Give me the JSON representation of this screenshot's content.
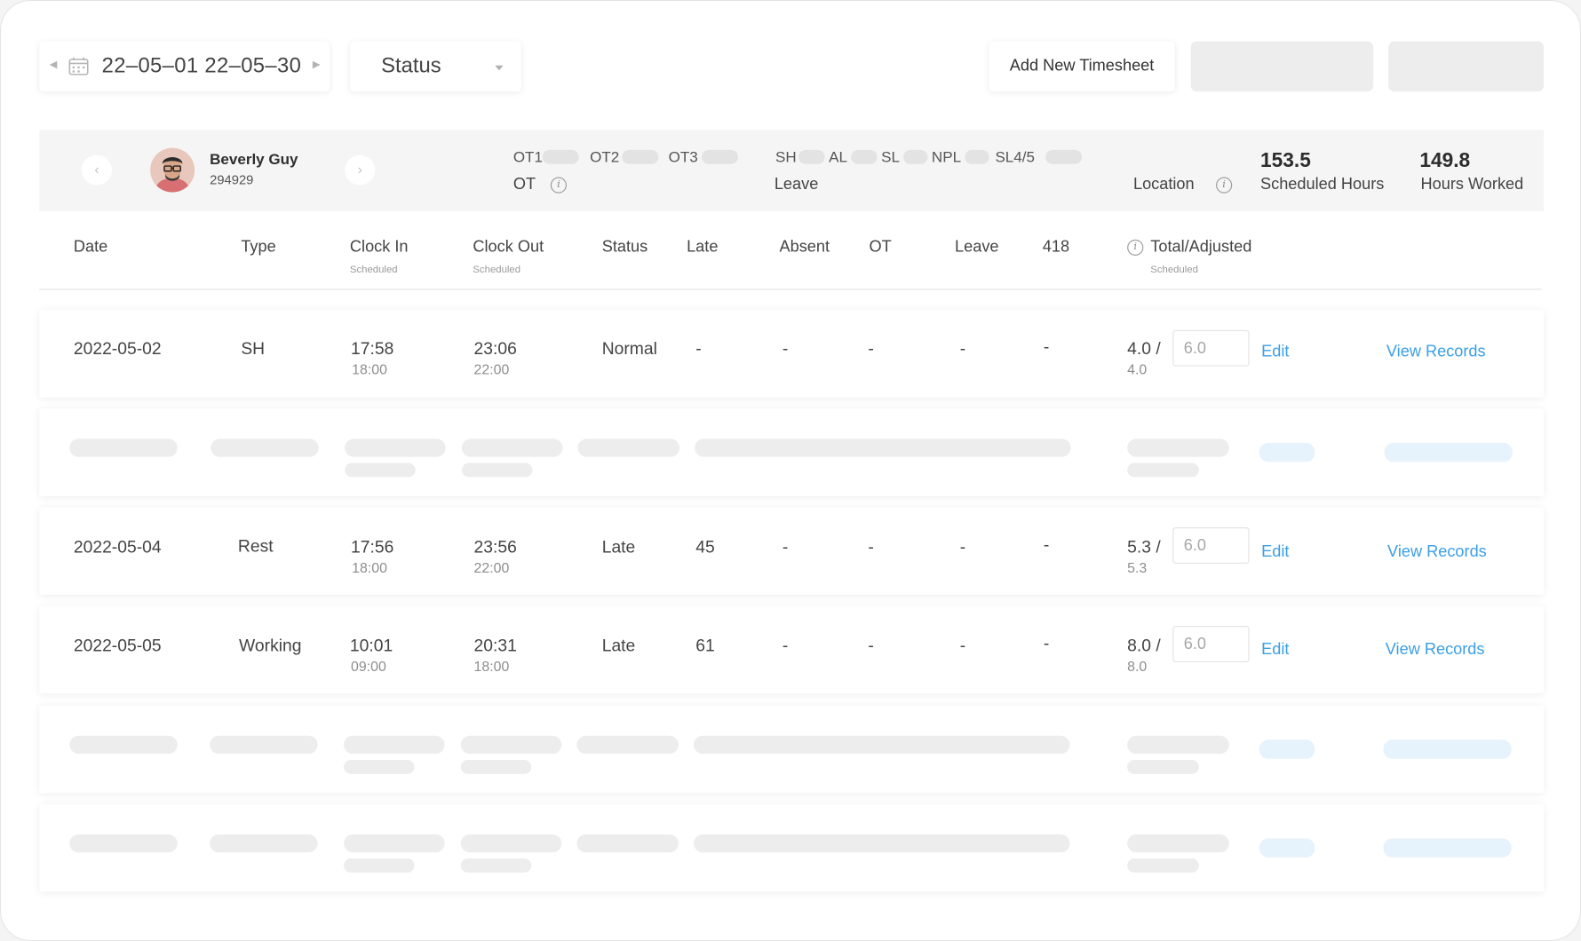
{
  "toolbar": {
    "date_range": "22–05–01 22–05–30",
    "status_filter": "Status",
    "add_button": "Add New Timesheet"
  },
  "employee": {
    "name": "Beverly Guy",
    "id": "294929",
    "ot_codes": [
      "OT1",
      "OT2",
      "OT3"
    ],
    "ot_label": "OT",
    "leave_codes": [
      "SH",
      "AL",
      "SL",
      "NPL",
      "SL4/5"
    ],
    "leave_label": "Leave",
    "location_label": "Location",
    "scheduled_hours": "153.5",
    "scheduled_hours_label": "Scheduled Hours",
    "hours_worked": "149.8",
    "hours_worked_label": "Hours Worked"
  },
  "columns": {
    "date": "Date",
    "type": "Type",
    "clock_in": "Clock In",
    "clock_in_sub": "Scheduled",
    "clock_out": "Clock Out",
    "clock_out_sub": "Scheduled",
    "status": "Status",
    "late": "Late",
    "absent": "Absent",
    "ot": "OT",
    "leave": "Leave",
    "extra": "418",
    "total": "Total/Adjusted",
    "total_sub": "Scheduled"
  },
  "rows": [
    {
      "date": "2022-05-02",
      "type": "SH",
      "clock_in": "17:58",
      "clock_in_sched": "18:00",
      "clock_out": "23:06",
      "clock_out_sched": "22:00",
      "status": "Normal",
      "late": "-",
      "absent": "-",
      "ot": "-",
      "leave": "-",
      "extra": "-",
      "total": "4.0 /",
      "total_sched": "4.0",
      "adjusted": "6.0",
      "edit": "Edit",
      "view": "View Records"
    },
    {
      "date": "2022-05-04",
      "type": "Rest",
      "clock_in": "17:56",
      "clock_in_sched": "18:00",
      "clock_out": "23:56",
      "clock_out_sched": "22:00",
      "status": "Late",
      "late": "45",
      "absent": "-",
      "ot": "-",
      "leave": "-",
      "extra": "-",
      "total": "5.3 /",
      "total_sched": "5.3",
      "adjusted": "6.0",
      "edit": "Edit",
      "view": "View Records"
    },
    {
      "date": "2022-05-05",
      "type": "Working",
      "clock_in": "10:01",
      "clock_in_sched": "09:00",
      "clock_out": "20:31",
      "clock_out_sched": "18:00",
      "status": "Late",
      "late": "61",
      "absent": "-",
      "ot": "-",
      "leave": "-",
      "extra": "-",
      "total": "8.0 /",
      "total_sched": "8.0",
      "adjusted": "6.0",
      "edit": "Edit",
      "view": "View Records"
    }
  ]
}
